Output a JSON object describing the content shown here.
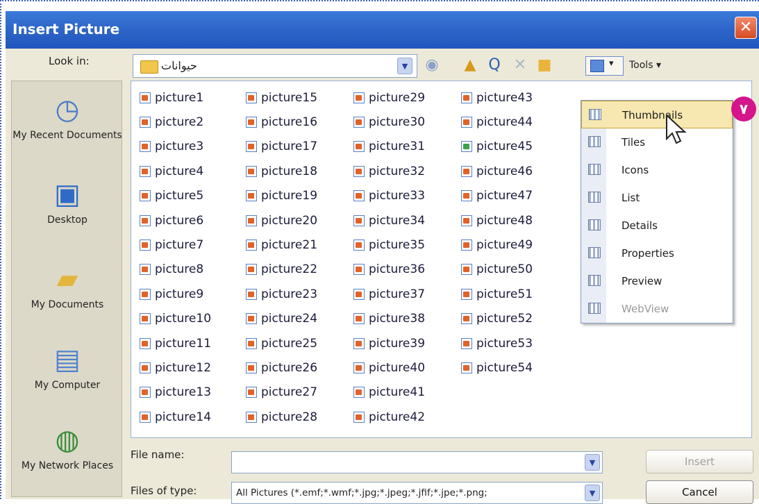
{
  "window": {
    "title": "Insert Picture",
    "close_symbol": "✕"
  },
  "toolbar": {
    "look_in_label": "Look in:",
    "look_in_value": "حیوانات",
    "views_menu": "▾",
    "tools_label": "Tools ▾"
  },
  "places": [
    {
      "label": "My Recent Documents",
      "icon": "recent-documents-icon"
    },
    {
      "label": "Desktop",
      "icon": "desktop-icon"
    },
    {
      "label": "My Documents",
      "icon": "my-documents-icon"
    },
    {
      "label": "My Computer",
      "icon": "my-computer-icon"
    },
    {
      "label": "My Network Places",
      "icon": "network-places-icon"
    }
  ],
  "files": {
    "col1": [
      "picture1",
      "picture2",
      "picture3",
      "picture4",
      "picture5",
      "picture6",
      "picture7",
      "picture8",
      "picture9",
      "picture10",
      "picture11",
      "picture12",
      "picture13",
      "picture14"
    ],
    "col2": [
      "picture15",
      "picture16",
      "picture17",
      "picture18",
      "picture19",
      "picture20",
      "picture21",
      "picture22",
      "picture23",
      "picture24",
      "picture25",
      "picture26",
      "picture27",
      "picture28"
    ],
    "col3": [
      "picture29",
      "picture30",
      "picture31",
      "picture32",
      "picture33",
      "picture34",
      "picture35",
      "picture36",
      "picture37",
      "picture38",
      "picture39",
      "picture40",
      "picture41",
      "picture42"
    ],
    "col4": [
      "picture43",
      "picture44",
      "picture45",
      "picture46",
      "picture47",
      "picture48",
      "picture49",
      "picture50",
      "picture51",
      "picture52",
      "picture53",
      "picture54"
    ]
  },
  "views_menu": {
    "items": [
      "Thumbnails",
      "Tiles",
      "Icons",
      "List",
      "Details",
      "Properties",
      "Preview",
      "WebView"
    ],
    "selected": "Thumbnails",
    "disabled": "WebView"
  },
  "step_badge": "٧",
  "bottom": {
    "file_name_label": "File name:",
    "file_name_value": "",
    "files_of_type_label": "Files of type:",
    "files_of_type_value": "All Pictures (*.emf;*.wmf;*.jpg;*.jpeg;*.jfif;*.jpe;*.png;",
    "insert_label": "Insert",
    "cancel_label": "Cancel"
  },
  "colors": {
    "titlebar": "#2f66c9",
    "dialog_bg": "#ece9d8",
    "badge": "#d4158c",
    "selection": "#f6e8b0"
  }
}
